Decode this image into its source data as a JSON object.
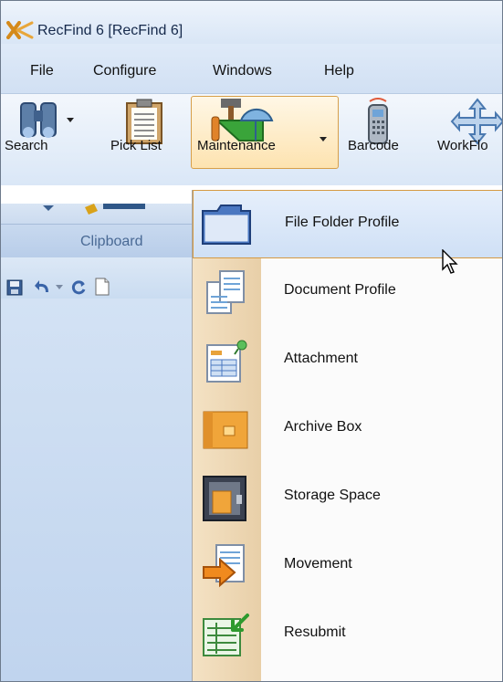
{
  "window": {
    "title": "RecFind 6 [RecFind 6]"
  },
  "menu": [
    "File",
    "Configure",
    "Windows",
    "Help"
  ],
  "ribbon": {
    "buttons": [
      "Search",
      "Pick List",
      "Maintenance",
      "Barcode",
      "WorkFlo"
    ]
  },
  "clipboard": {
    "group_label": "Clipboard"
  },
  "dropdown": {
    "items": [
      {
        "label": "File Folder Profile",
        "icon": "folder-icon"
      },
      {
        "label": "Document Profile",
        "icon": "document-profile-icon"
      },
      {
        "label": "Attachment",
        "icon": "attachment-icon"
      },
      {
        "label": "Archive Box",
        "icon": "archive-box-icon"
      },
      {
        "label": "Storage Space",
        "icon": "storage-space-icon"
      },
      {
        "label": "Movement",
        "icon": "movement-icon"
      },
      {
        "label": "Resubmit",
        "icon": "resubmit-icon"
      }
    ]
  },
  "colors": {
    "accent_hover_border": "#d59a43",
    "ribbon_blue": "#d9e6f6",
    "menu_gutter": "#f0dcb9"
  }
}
